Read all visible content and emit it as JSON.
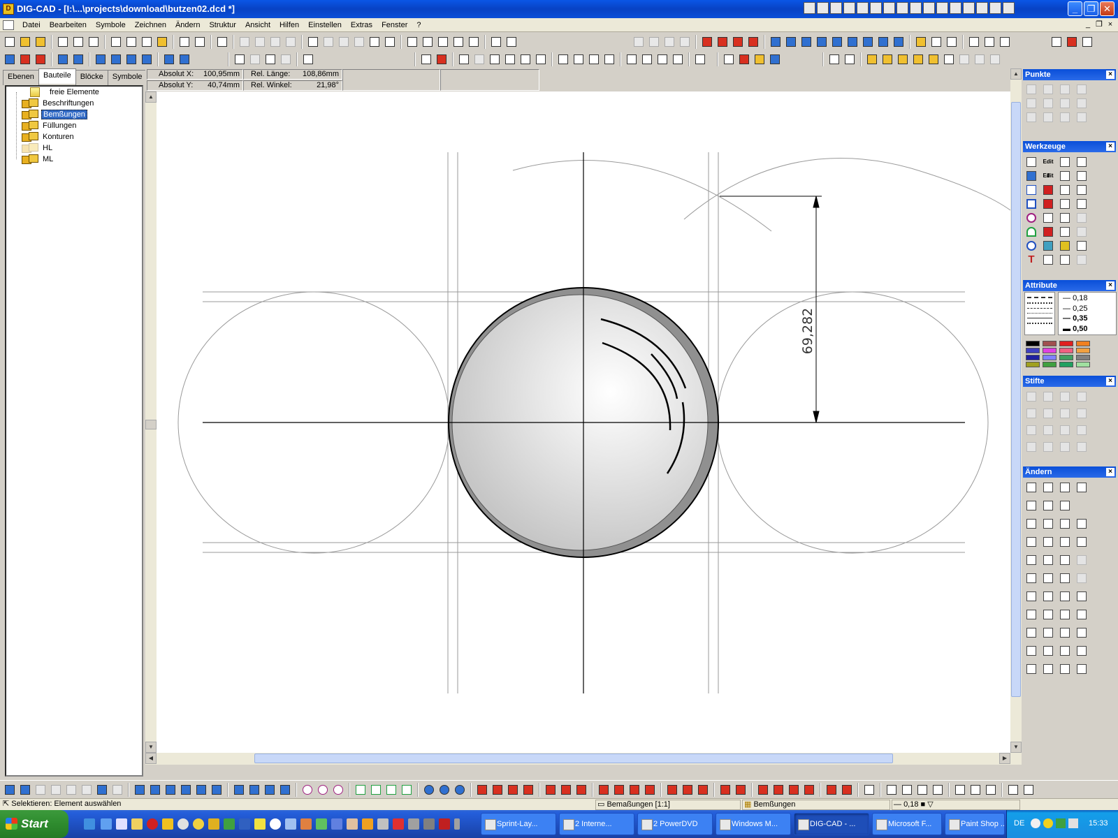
{
  "window": {
    "app_icon_label": "D",
    "title": "DIG-CAD - [I:\\...\\projects\\download\\butzen02.dcd *]",
    "min_label": "_",
    "max_label": "❐",
    "close_label": "✕"
  },
  "menubar": {
    "items": [
      "Datei",
      "Bearbeiten",
      "Symbole",
      "Zeichnen",
      "Ändern",
      "Struktur",
      "Ansicht",
      "Hilfen",
      "Einstellen",
      "Extras",
      "Fenster",
      "?"
    ],
    "mdi_min": "_",
    "mdi_restore": "❐",
    "mdi_close": "×"
  },
  "left_panel": {
    "tabs": [
      "Ebenen",
      "Bauteile",
      "Blöcke",
      "Symbole"
    ],
    "active_tab": "Bauteile",
    "tree": [
      {
        "label": "freie Elemente",
        "type": "folder"
      },
      {
        "label": "Beschriftungen",
        "type": "layer"
      },
      {
        "label": "Bemßungen",
        "type": "layer",
        "selected": true
      },
      {
        "label": "Füllungen",
        "type": "layer"
      },
      {
        "label": "Konturen",
        "type": "layer"
      },
      {
        "label": "HL",
        "type": "layer-dim"
      },
      {
        "label": "ML",
        "type": "layer"
      }
    ]
  },
  "coords": {
    "abs_x_label": "Absolut X:",
    "abs_x_value": "100,95mm",
    "abs_y_label": "Absolut Y:",
    "abs_y_value": "40,74mm",
    "rel_len_label": "Rel. Länge:",
    "rel_len_value": "108,86mm",
    "rel_angle_label": "Rel. Winkel:",
    "rel_angle_value": "21,98°"
  },
  "drawing": {
    "dimension_text": "69,282"
  },
  "palettes": {
    "punkte": "Punkte",
    "werkzeuge": "Werkzeuge",
    "attribute": "Attribute",
    "stifte": "Stifte",
    "aendern": "Ändern",
    "close_label": "×",
    "line_widths": [
      "0,18",
      "0,25",
      "0,35",
      "0,50"
    ],
    "werkzeuge_edit1": "Edit 1",
    "werkzeuge_edit2": "Edit 2",
    "swatch_colors": [
      "#000000",
      "#a05050",
      "#e02020",
      "#f08020",
      "#4040c0",
      "#e040e0",
      "#f06080",
      "#f0a040",
      "#2020a0",
      "#8080ff",
      "#40a060",
      "#808080",
      "#a0a020",
      "#40a040",
      "#20a060",
      "#a0e0a0"
    ]
  },
  "statusbar": {
    "message": "Selektieren: Element auswählen",
    "view": "Bemaßungen [1:1]",
    "layer": "Bemßungen",
    "line_width": "0,18"
  },
  "taskbar": {
    "start_label": "Start",
    "tasks": [
      {
        "label": "Sprint-Lay..."
      },
      {
        "label": "2 Interne..."
      },
      {
        "label": "2 PowerDVD"
      },
      {
        "label": "Windows M..."
      },
      {
        "label": "DIG-CAD - ...",
        "active": true
      },
      {
        "label": "Microsoft F..."
      },
      {
        "label": "Paint Shop ..."
      }
    ],
    "lang": "DE",
    "time": "15:33"
  }
}
